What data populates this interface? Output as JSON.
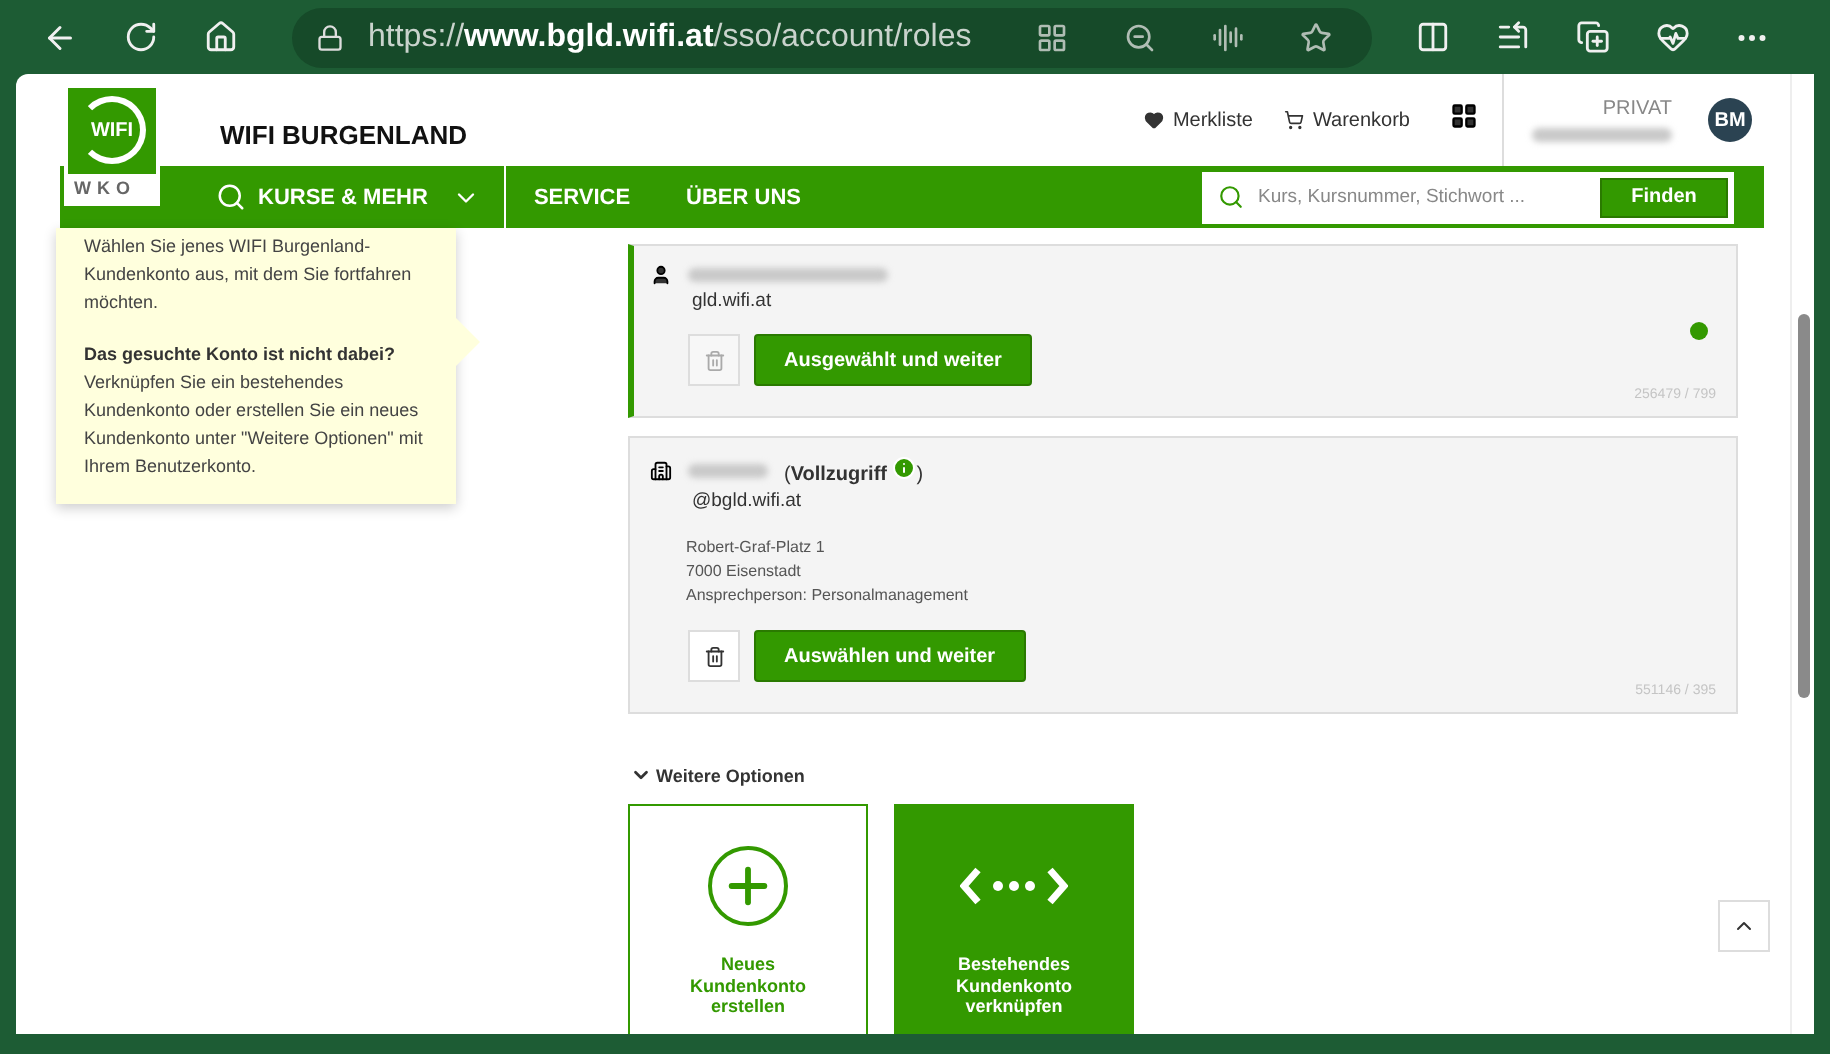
{
  "browser": {
    "url_scheme": "https://",
    "url_domain": "www.bgld.wifi.at",
    "url_path": "/sso/account/roles"
  },
  "header": {
    "logo_top": "WIFI",
    "logo_bottom": "WKO",
    "site_title": "WIFI BURGENLAND",
    "links": [
      {
        "label": "Merkliste",
        "kind": "heart"
      },
      {
        "label": "Warenkorb",
        "kind": "cart"
      }
    ],
    "account_type": "PRIVAT",
    "avatar": "BM"
  },
  "nav": {
    "items": [
      {
        "label": "KURSE & MEHR",
        "kind": "dropdown"
      },
      {
        "label": "SERVICE",
        "kind": "link"
      },
      {
        "label": "ÜBER UNS",
        "kind": "link"
      }
    ],
    "search": {
      "placeholder": "Kurs, Kursnummer, Stichwort ...",
      "button": "Finden"
    }
  },
  "hint": {
    "intro": "Wählen Sie jenes WIFI Burgenland-Kundenkonto aus, mit dem Sie fortfahren möchten.",
    "heading": "Das gesuchte Konto ist nicht dabei?",
    "body": "Verknüpfen Sie ein bestehendes Kundenkonto oder erstellen Sie ein neues Kundenkonto unter \"Weitere Optionen\" mit Ihrem Benutzerkonto."
  },
  "accounts": [
    {
      "kind": "person",
      "selected": true,
      "email": "gld.wifi.at",
      "button": "Ausgewählt und weiter",
      "delete_disabled": true,
      "number": "256479 / 799"
    },
    {
      "kind": "company",
      "selected": false,
      "access": "(**Vollzugriff**",
      "access_close": ")",
      "email": "@bgld.wifi.at",
      "address": [
        "Robert-Graf-Platz 1",
        "7000 Eisenstadt",
        "Ansprechperson: Personalmanagement"
      ],
      "button": "Auswählen und weiter",
      "delete_disabled": false,
      "number": "551146 / 395"
    }
  ],
  "more_options": {
    "label": "Weitere Optionen",
    "expanded": true,
    "tiles": [
      {
        "kind": "create",
        "label": "Neues Kundenkonto erstellen"
      },
      {
        "kind": "link",
        "label": "Bestehendes Kundenkonto verknüpfen"
      }
    ]
  }
}
